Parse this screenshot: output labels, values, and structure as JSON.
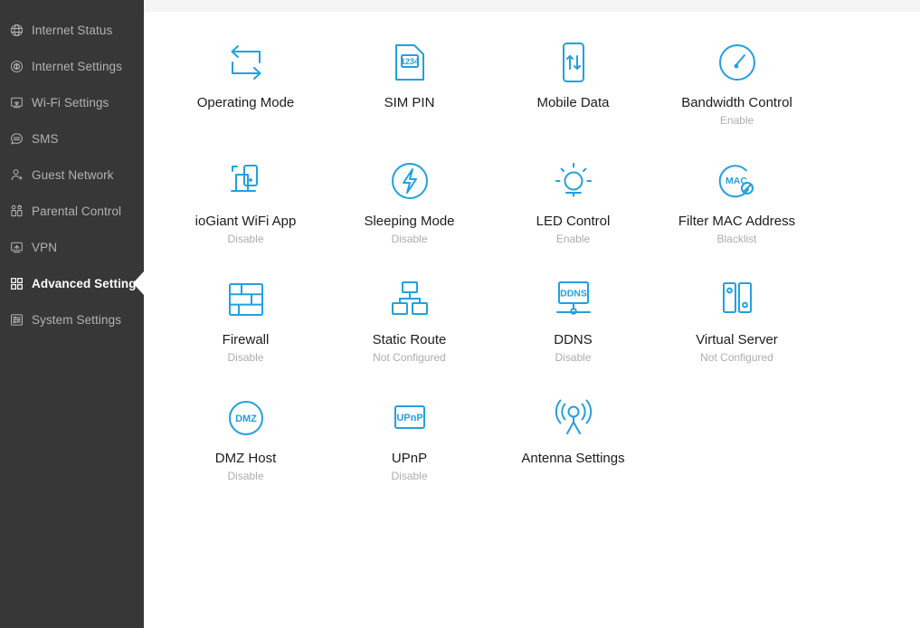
{
  "theme": {
    "sidebar_bg": "#373737",
    "sidebar_text": "#b2b2b2",
    "sidebar_text_active": "#ffffff",
    "content_bg": "#ffffff",
    "topbar_bg": "#f5f5f5",
    "icon_blue": "#22a0e0",
    "label_color": "#1c1c1c",
    "sublabel_color": "#adadad"
  },
  "sidebar": {
    "items": [
      {
        "label": "Internet Status",
        "icon": "globe-icon",
        "active": false
      },
      {
        "label": "Internet Settings",
        "icon": "globe-gear-icon",
        "active": false
      },
      {
        "label": "Wi-Fi Settings",
        "icon": "wifi-monitor-icon",
        "active": false
      },
      {
        "label": "SMS",
        "icon": "message-icon",
        "active": false
      },
      {
        "label": "Guest Network",
        "icon": "guest-user-icon",
        "active": false
      },
      {
        "label": "Parental Control",
        "icon": "parental-people-icon",
        "active": false
      },
      {
        "label": "VPN",
        "icon": "vpn-monitor-icon",
        "active": false
      },
      {
        "label": "Advanced Settings",
        "icon": "grid-squares-icon",
        "active": true
      },
      {
        "label": "System Settings",
        "icon": "sliders-icon",
        "active": false
      }
    ]
  },
  "main": {
    "tiles": [
      {
        "label": "Operating Mode",
        "status": "",
        "icon": "loop-arrows-icon"
      },
      {
        "label": "SIM PIN",
        "status": "",
        "icon": "sim-card-1234-icon"
      },
      {
        "label": "Mobile Data",
        "status": "",
        "icon": "mobile-data-icon"
      },
      {
        "label": "Bandwidth Control",
        "status": "Enable",
        "icon": "gauge-icon"
      },
      {
        "label": "ioGiant WiFi App",
        "status": "Disable",
        "icon": "laptop-phone-icon"
      },
      {
        "label": "Sleeping Mode",
        "status": "Disable",
        "icon": "bolt-circle-icon"
      },
      {
        "label": "LED Control",
        "status": "Enable",
        "icon": "led-bulb-icon"
      },
      {
        "label": "Filter MAC Address",
        "status": "Blacklist",
        "icon": "mac-block-icon"
      },
      {
        "label": "Firewall",
        "status": "Disable",
        "icon": "brick-wall-icon"
      },
      {
        "label": "Static Route",
        "status": "Not Configured",
        "icon": "network-tree-icon"
      },
      {
        "label": "DDNS",
        "status": "Disable",
        "icon": "ddns-monitor-icon"
      },
      {
        "label": "Virtual Server",
        "status": "Not Configured",
        "icon": "server-racks-icon"
      },
      {
        "label": "DMZ Host",
        "status": "Disable",
        "icon": "dmz-circle-icon"
      },
      {
        "label": "UPnP",
        "status": "Disable",
        "icon": "upnp-box-icon"
      },
      {
        "label": "Antenna Settings",
        "status": "",
        "icon": "antenna-icon"
      }
    ]
  }
}
